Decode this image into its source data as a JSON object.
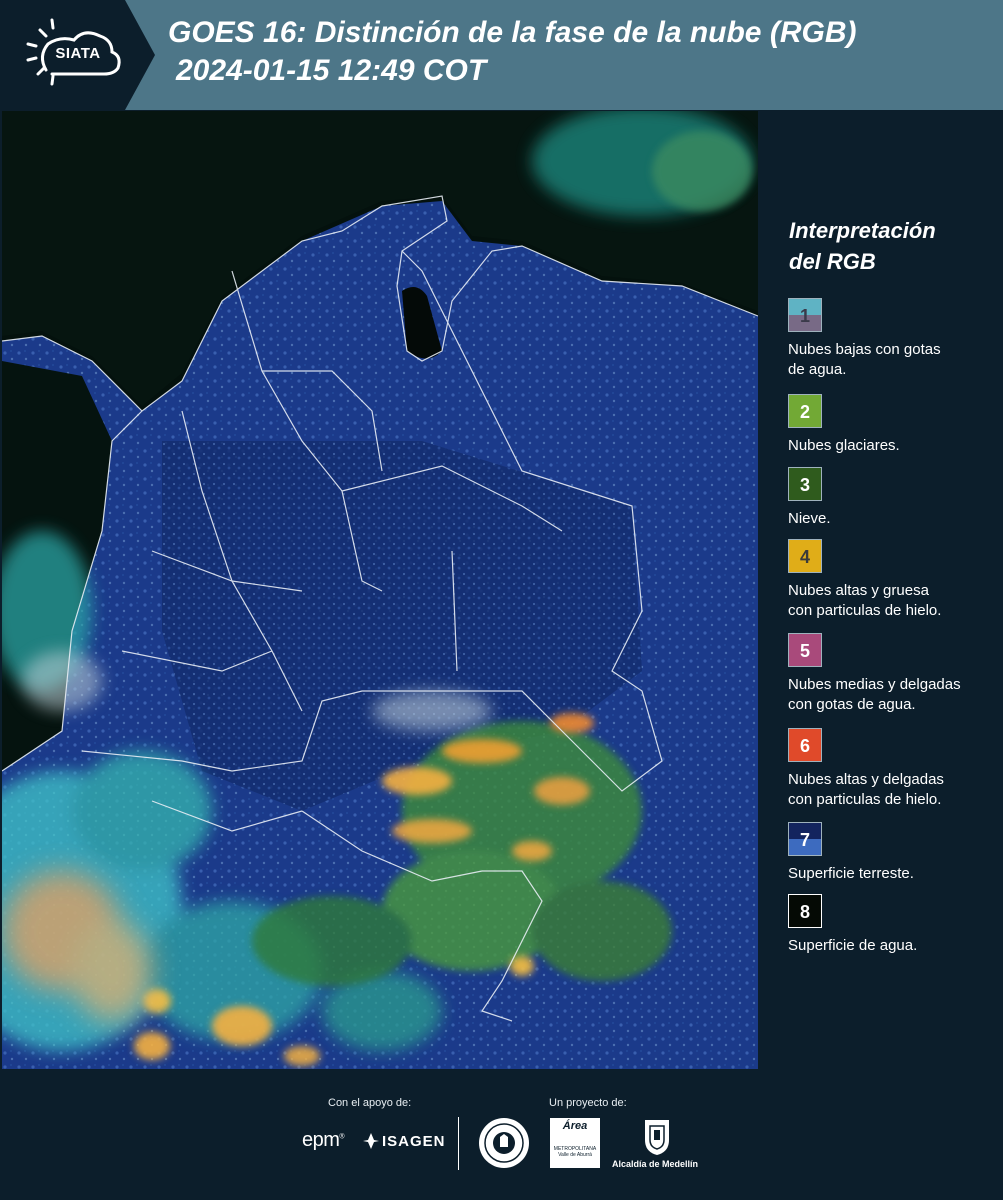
{
  "header": {
    "logo_text": "SIATA",
    "title_line1": "GOES 16: Distinción de la fase de la nube (RGB)",
    "title_line2": "2024-01-15 12:49 COT"
  },
  "legend": {
    "title_line1": "Interpretación",
    "title_line2": "del RGB",
    "items": [
      {
        "number": "1",
        "label_line1": "Nubes bajas con gotas",
        "label_line2": "de agua.",
        "color_top": "#5fb3c4",
        "color_bottom": "#786a86",
        "text_color": "#3a3a4a"
      },
      {
        "number": "2",
        "label_line1": "Nubes glaciares.",
        "label_line2": "",
        "color_top": "#72a935",
        "color_bottom": "#72a935",
        "text_color": "#ffffff"
      },
      {
        "number": "3",
        "label_line1": "Nieve.",
        "label_line2": "",
        "color_top": "#2f5b1d",
        "color_bottom": "#2f5b1d",
        "text_color": "#ffffff"
      },
      {
        "number": "4",
        "label_line1": "Nubes altas y gruesa",
        "label_line2": "con particulas de hielo.",
        "color_top": "#e0ad18",
        "color_bottom": "#e0ad18",
        "text_color": "#3a3a3a"
      },
      {
        "number": "5",
        "label_line1": "Nubes medias y delgadas",
        "label_line2": "con gotas de agua.",
        "color_top": "#a94a7b",
        "color_bottom": "#a94a7b",
        "text_color": "#ffffff"
      },
      {
        "number": "6",
        "label_line1": "Nubes altas y delgadas",
        "label_line2": "con particulas de hielo.",
        "color_top": "#e04a2a",
        "color_bottom": "#e04a2a",
        "text_color": "#ffffff"
      },
      {
        "number": "7",
        "label_line1": "Superficie terreste.",
        "label_line2": "",
        "color_top": "#13245e",
        "color_bottom": "#3d6bbf",
        "text_color": "#ffffff"
      },
      {
        "number": "8",
        "label_line1": "Superficie de agua.",
        "label_line2": "",
        "color_top": "#050a05",
        "color_bottom": "#050a05",
        "text_color": "#ffffff"
      }
    ]
  },
  "footer": {
    "support_label": "Con el apoyo de:",
    "project_label": "Un proyecto de:",
    "sponsor_1": "epm",
    "sponsor_2": "ISAGEN",
    "partner_area": "Área",
    "partner_area_sub": "METROPOLITANA Valle de Aburrá",
    "partner_alcaldia": "Alcaldía de Medellín"
  }
}
